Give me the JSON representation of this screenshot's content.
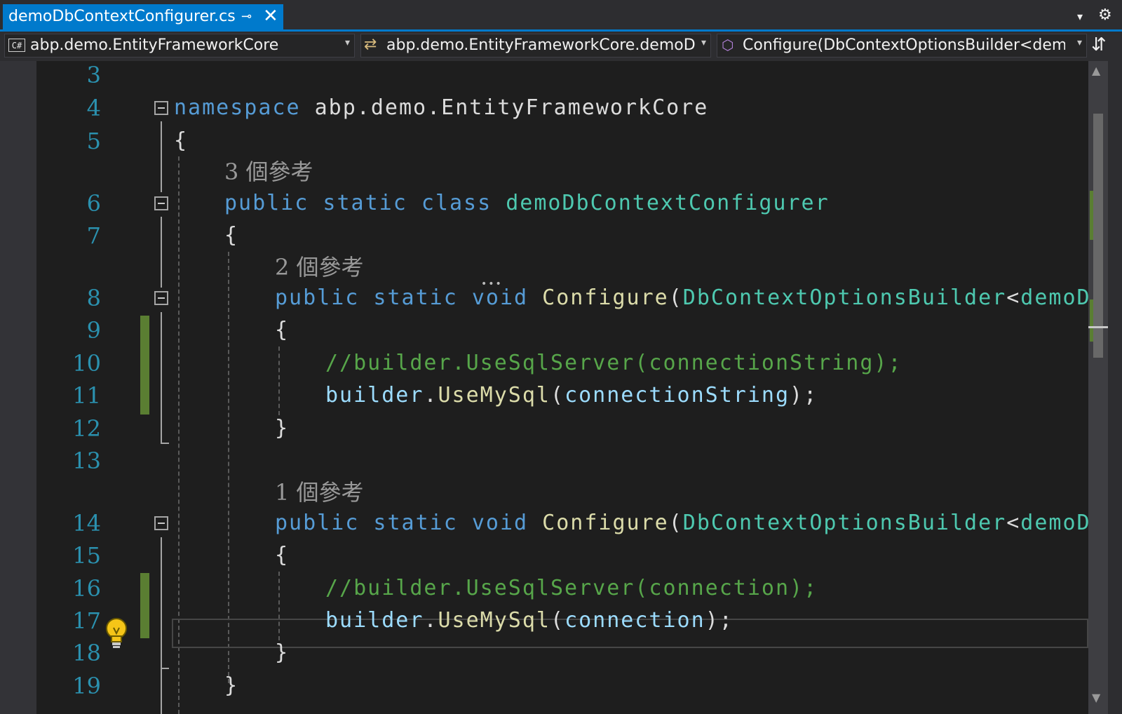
{
  "tab": {
    "title": "demoDbContextConfigurer.cs",
    "pin_icon": "⊸",
    "close_icon": "✕"
  },
  "toolbar": {
    "overflow_icon": "▾",
    "settings_icon": "⚙"
  },
  "nav": {
    "project": "abp.demo.EntityFrameworkCore",
    "type_member": "abp.demo.EntityFrameworkCore.demoDbC",
    "member": "Configure(DbContextOptionsBuilder<dem",
    "csharp_badge": "C#",
    "split_icon": "⇵",
    "dropdown_arrow": "▾"
  },
  "lens": {
    "refs_3": "3 個參考",
    "refs_2": "2 個參考",
    "refs_1": "1 個參考"
  },
  "line_numbers": {
    "l3": "3",
    "l4": "4",
    "l5": "5",
    "l6": "6",
    "l7": "7",
    "l8": "8",
    "l9": "9",
    "l10": "10",
    "l11": "11",
    "l12": "12",
    "l13": "13",
    "l14": "14",
    "l15": "15",
    "l16": "16",
    "l17": "17",
    "l18": "18",
    "l19": "19"
  },
  "code": {
    "namespace_kw": "namespace",
    "namespace_name": "abp.demo.EntityFrameworkCore",
    "open_brace": "{",
    "close_brace": "}",
    "public_static_class": "public static class",
    "class_name": "demoDbContextConfigurer",
    "public_static_void": "public static void",
    "method_name": "Configure",
    "paren_open": "(",
    "param_type": "DbContextOptionsBuilder",
    "lt": "<",
    "generic_arg": "demoDbContex",
    "comment1": "//builder.UseSqlServer(connectionString);",
    "comment2": "//builder.UseSqlServer(connection);",
    "builder": "builder",
    "dot": ".",
    "use_mysql": "UseMySql",
    "arg_connection_string": "connectionString",
    "arg_connection": "connection",
    "call_end": ");"
  },
  "colors": {
    "accent": "#007acc",
    "keyword": "#569cd6",
    "type": "#4ec9b0",
    "method": "#dcdcaa",
    "variable": "#9cdcfe",
    "comment": "#57a64a",
    "line_number": "#2b91af",
    "change_marker": "#5a7e32"
  },
  "icons": {
    "lightbulb": "lightbulb-icon",
    "fold": "collapse-icon"
  }
}
